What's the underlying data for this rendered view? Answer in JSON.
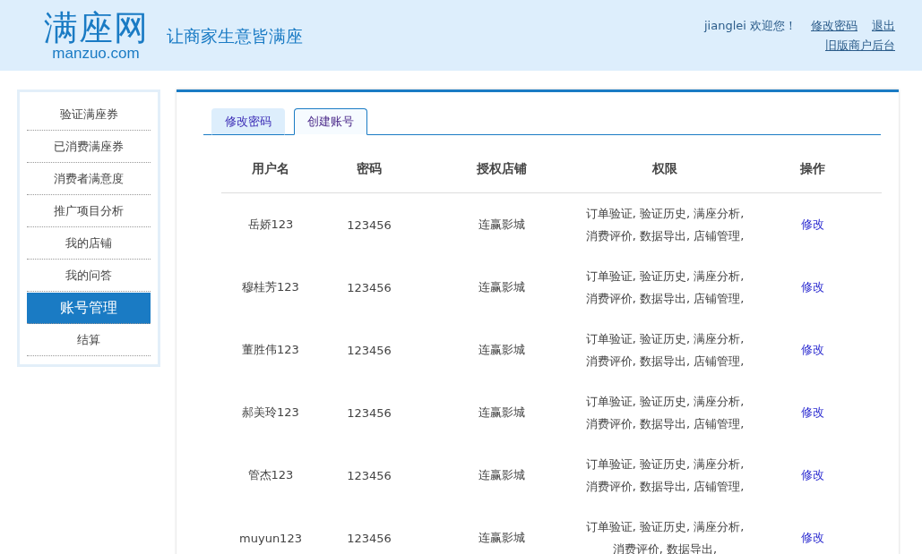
{
  "header": {
    "logo": "满座网",
    "logo_domain": "manzuo.com",
    "slogan": "让商家生意皆满座",
    "user": "jianglei 欢迎您！",
    "links": [
      "修改密码",
      "退出"
    ],
    "old_link": "旧版商户后台"
  },
  "sidebar": {
    "items": [
      {
        "label": "验证满座券",
        "selected": false
      },
      {
        "label": "已消费满座券",
        "selected": false
      },
      {
        "label": "消费者满意度",
        "selected": false
      },
      {
        "label": "推广项目分析",
        "selected": false
      },
      {
        "label": "我的店铺",
        "selected": false
      },
      {
        "label": "我的问答",
        "selected": false
      },
      {
        "label": "账号管理",
        "selected": true
      },
      {
        "label": "结算",
        "selected": false
      }
    ]
  },
  "tabs": [
    {
      "label": "修改密码",
      "selected": false
    },
    {
      "label": "创建账号",
      "selected": true
    }
  ],
  "table": {
    "columns": [
      "用户名",
      "密码",
      "授权店铺",
      "权限",
      "操作"
    ],
    "rows": [
      {
        "user": "岳娇123",
        "password": "123456",
        "shop": "连赢影城",
        "permissions": [
          "订单验证, 验证历史, 满座分析,",
          "消费评价, 数据导出, 店铺管理,"
        ],
        "action": "修改"
      },
      {
        "user": "穆桂芳123",
        "password": "123456",
        "shop": "连赢影城",
        "permissions": [
          "订单验证, 验证历史, 满座分析,",
          "消费评价, 数据导出, 店铺管理,"
        ],
        "action": "修改"
      },
      {
        "user": "董胜伟123",
        "password": "123456",
        "shop": "连赢影城",
        "permissions": [
          "订单验证, 验证历史, 满座分析,",
          "消费评价, 数据导出, 店铺管理,"
        ],
        "action": "修改"
      },
      {
        "user": "郝美玲123",
        "password": "123456",
        "shop": "连赢影城",
        "permissions": [
          "订单验证, 验证历史, 满座分析,",
          "消费评价, 数据导出, 店铺管理,"
        ],
        "action": "修改"
      },
      {
        "user": "管杰123",
        "password": "123456",
        "shop": "连赢影城",
        "permissions": [
          "订单验证, 验证历史, 满座分析,",
          "消费评价, 数据导出, 店铺管理,"
        ],
        "action": "修改"
      },
      {
        "user": "muyun123",
        "password": "123456",
        "shop": "连赢影城",
        "permissions": [
          "订单验证, 验证历史, 满座分析,",
          "消费评价, 数据导出,"
        ],
        "action": "修改"
      }
    ]
  }
}
